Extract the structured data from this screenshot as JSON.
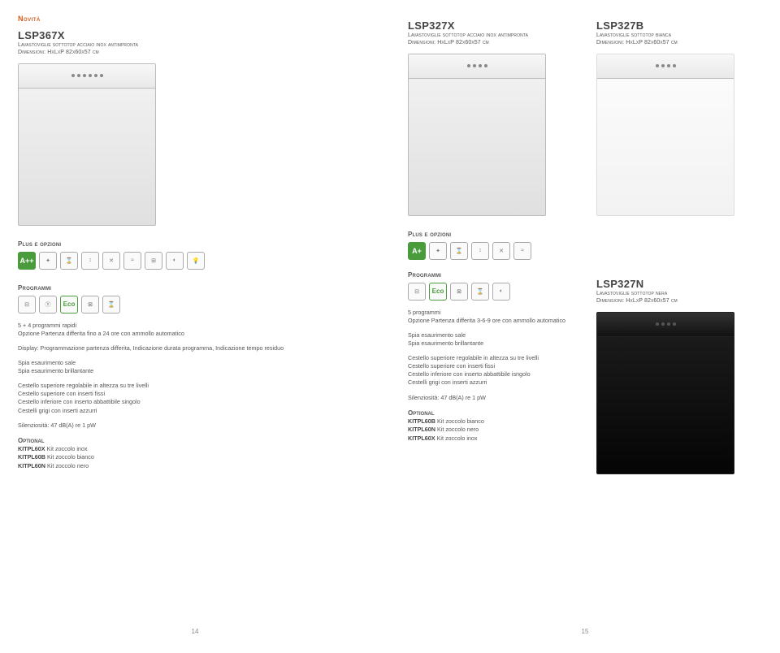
{
  "novita": "Novità",
  "products": {
    "lsp367x": {
      "model": "LSP367X",
      "desc": "Lavastoviglie sottotop acciaio inox antimpronta",
      "dim": "Dimensioni: HxLxP 82x60x57 cm"
    },
    "lsp327x": {
      "model": "LSP327X",
      "desc": "Lavastoviglie sottotop acciaio inox antimpronta",
      "dim": "Dimensioni: HxLxP 82x60x57 cm"
    },
    "lsp327b": {
      "model": "LSP327B",
      "desc": "Lavastoviglie sottotop bianca",
      "dim": "Dimensioni: HxLxP 82x60x57 cm"
    },
    "lsp327n": {
      "model": "LSP327N",
      "desc": "Lavastoviglie sottotop nera",
      "dim": "Dimensioni: HxLxP 82x60x57 cm"
    }
  },
  "labels": {
    "plus": "Plus e opzioni",
    "programmi": "Programmi",
    "optional": "Optional"
  },
  "icons": {
    "app": "A++",
    "ap": "A+",
    "eco": "Eco"
  },
  "left_text": {
    "prog": "5 + 4 programmi rapidi\nOpzione Partenza differita fino a 24 ore con ammollo automatico",
    "display": "Display: Programmazione partenza differita, Indicazione durata programma, Indicazione tempo residuo",
    "spia": "Spia esaurimento sale\nSpia esaurimento brillantante",
    "cest": "Cestello superiore regolabile in altezza su tre livelli\nCestello superiore con inserti fissi\nCestello inferiore con inserto abbattibile singolo\nCestelli grigi con inserti azzurri",
    "sil": "Silenziosità: 47 dB(A) re 1 pW"
  },
  "left_optional": [
    {
      "code": "KITPL60X",
      "label": "Kit zoccolo inox"
    },
    {
      "code": "KITPL60B",
      "label": "Kit zoccolo bianco"
    },
    {
      "code": "KITPL60N",
      "label": "Kit zoccolo nero"
    }
  ],
  "right_text": {
    "prog": "5 programmi\nOpzione Partenza differita 3-6-9 ore con ammollo automatico",
    "spia": "Spia esaurimento sale\nSpia esaurimento brillantante",
    "cest": "Cestello superiore regolabile in altezza su tre livelli\nCestello superiore con inserti fissi\nCestello inferiore con inserto abbattibile isngolo\nCestelli grigi con inserti azzurri",
    "sil": "Silenziosità: 47 dB(A) re 1 pW"
  },
  "right_optional": [
    {
      "code": "KITPL60B",
      "label": "Kit zoccolo bianco"
    },
    {
      "code": "KITPL60N",
      "label": "Kit zoccolo nero"
    },
    {
      "code": "KITPL60X",
      "label": "Kit zoccolo inox"
    }
  ],
  "pagenums": {
    "left": "14",
    "right": "15"
  }
}
